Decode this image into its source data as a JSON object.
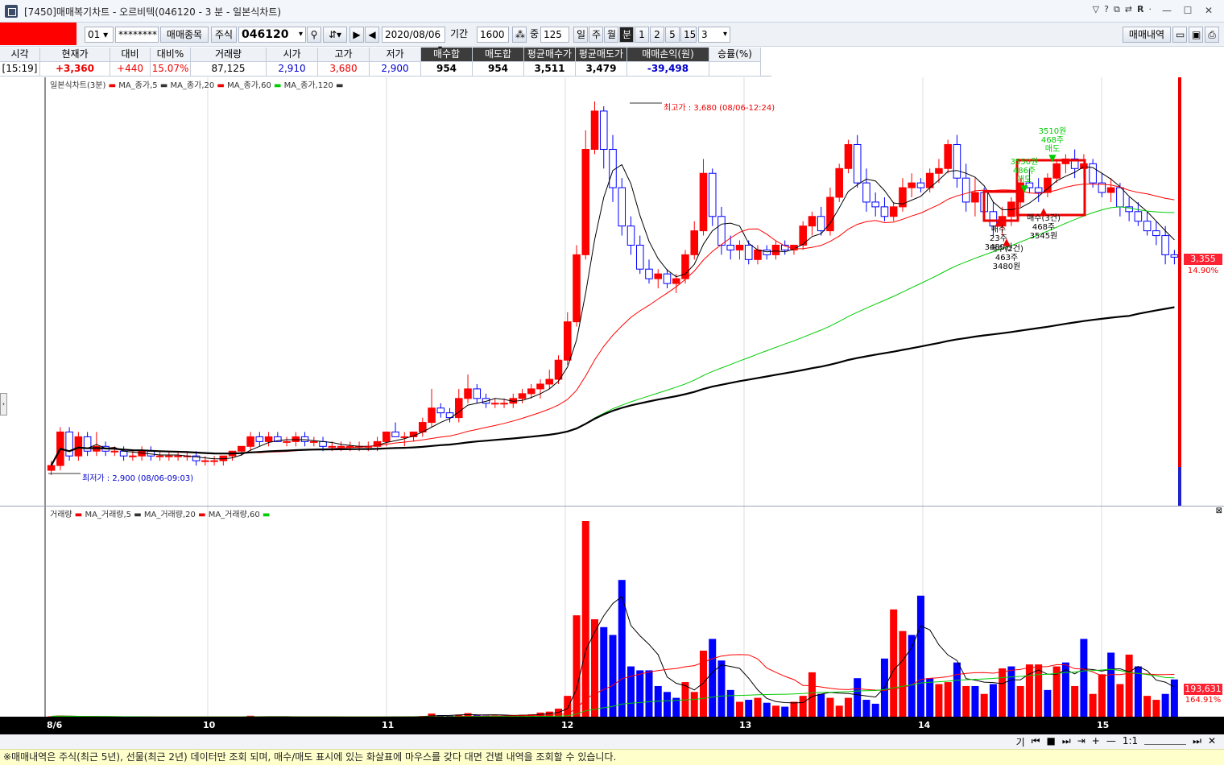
{
  "window": {
    "title": "[7450]매매복기차트 - 오르비텍(046120 - 3 분 - 일본식차트)",
    "icons": [
      "help-icon",
      "question-icon",
      "copy-icon",
      "sync-icon",
      "r-icon",
      "pin-icon",
      "minimize-icon",
      "maximize-icon",
      "close-icon"
    ]
  },
  "toolbar": {
    "account": "01",
    "password": "********",
    "trade_item_btn": "매매종목",
    "market": "주식",
    "code": "046120",
    "date": "2020/08/06",
    "period_label": "기간",
    "period_value": "1600",
    "count_label": "중",
    "count_value": "125",
    "periods": [
      "일",
      "주",
      "월",
      "분"
    ],
    "active_period": "분",
    "minutes": [
      "1",
      "2",
      "5",
      "15"
    ],
    "minute_select": "3",
    "history_btn": "매매내역"
  },
  "quote": {
    "headers": [
      "시각",
      "현재가",
      "대비",
      "대비%",
      "거래량",
      "시가",
      "고가",
      "저가",
      "매수합",
      "매도합",
      "평균매수가",
      "평균매도가",
      "매매손익(원)",
      "승률(%)"
    ],
    "values": [
      "[15:19]",
      "+3,360",
      "+440",
      "15.07%",
      "87,125",
      "2,910",
      "3,680",
      "2,900",
      "954",
      "954",
      "3,511",
      "3,479",
      "-39,498",
      ""
    ]
  },
  "price_panel": {
    "legend_title": "일본식차트(3분)",
    "legend_items": [
      "MA_종가,5",
      "MA_종가,20",
      "MA_종가,60",
      "MA_종가,120"
    ],
    "high_label": "최고가 : 3,680 (08/06-12:24)",
    "low_label": "최저가 : 2,900 (08/06-09:03)",
    "current_price": "3,355",
    "current_pct": "14.90%"
  },
  "trade_marks": [
    {
      "side": "sell",
      "lines": [
        "3510원",
        "468주",
        "매도"
      ]
    },
    {
      "side": "sell",
      "lines": [
        "3550원",
        "486주",
        "매도"
      ]
    },
    {
      "side": "buy",
      "lines": [
        "매수(3건)",
        "468주",
        "3545원"
      ]
    },
    {
      "side": "buy",
      "lines": [
        "매수",
        "23주",
        "3480원"
      ]
    },
    {
      "side": "buy",
      "lines": [
        "매수(2건)",
        "463주",
        "3480원"
      ]
    }
  ],
  "volume_panel": {
    "legend_title": "거래량",
    "legend_items": [
      "MA_거래량,5",
      "MA_거래량,20",
      "MA_거래량,60"
    ],
    "current_volume": "193,631",
    "current_pct": "164.91%"
  },
  "x_axis": {
    "labels": [
      "8/6",
      "10",
      "11",
      "12",
      "13",
      "14",
      "15"
    ]
  },
  "bottom_tools": [
    "기",
    "1:1"
  ],
  "status_text": "※매매내역은 주식(최근 5년), 선물(최근 2년) 데이터만 조회 되며, 매수/매도 표시에 있는 화살표에 마우스를 갖다 대면 건별 내역을 조회할 수 있습니다.",
  "colors": {
    "up": "#ff0000",
    "down": "#0000ff",
    "ma5": "#000000",
    "ma20": "#ff0000",
    "ma60": "#00cc00",
    "ma120": "#000000"
  },
  "chart_data": {
    "type": "candlestick",
    "price_axis": {
      "min": 2900,
      "max": 3680
    },
    "candles": [
      [
        2910,
        2930,
        2900,
        2920
      ],
      [
        2920,
        3000,
        2910,
        2990
      ],
      [
        2990,
        3000,
        2930,
        2940
      ],
      [
        2940,
        2990,
        2930,
        2980
      ],
      [
        2980,
        2990,
        2940,
        2950
      ],
      [
        2950,
        2990,
        2940,
        2960
      ],
      [
        2960,
        2970,
        2940,
        2950
      ],
      [
        2950,
        2960,
        2940,
        2950
      ],
      [
        2950,
        2960,
        2930,
        2940
      ],
      [
        2940,
        2950,
        2930,
        2940
      ],
      [
        2940,
        2960,
        2930,
        2950
      ],
      [
        2950,
        2960,
        2930,
        2940
      ],
      [
        2940,
        2950,
        2930,
        2940
      ],
      [
        2940,
        2950,
        2930,
        2940
      ],
      [
        2940,
        2950,
        2930,
        2940
      ],
      [
        2940,
        2950,
        2930,
        2940
      ],
      [
        2940,
        2950,
        2920,
        2930
      ],
      [
        2930,
        2940,
        2920,
        2930
      ],
      [
        2930,
        2940,
        2920,
        2930
      ],
      [
        2930,
        2940,
        2920,
        2940
      ],
      [
        2940,
        2950,
        2930,
        2950
      ],
      [
        2950,
        2960,
        2940,
        2960
      ],
      [
        2960,
        2990,
        2950,
        2980
      ],
      [
        2980,
        2990,
        2960,
        2970
      ],
      [
        2970,
        2990,
        2960,
        2980
      ],
      [
        2980,
        2990,
        2970,
        2970
      ],
      [
        2970,
        2980,
        2960,
        2970
      ],
      [
        2970,
        2990,
        2960,
        2980
      ],
      [
        2980,
        2990,
        2960,
        2970
      ],
      [
        2970,
        2980,
        2960,
        2970
      ],
      [
        2970,
        2980,
        2950,
        2960
      ],
      [
        2960,
        2970,
        2950,
        2960
      ],
      [
        2960,
        2970,
        2950,
        2960
      ],
      [
        2960,
        2970,
        2950,
        2960
      ],
      [
        2960,
        2970,
        2950,
        2960
      ],
      [
        2960,
        2970,
        2950,
        2960
      ],
      [
        2960,
        2980,
        2950,
        2970
      ],
      [
        2970,
        2990,
        2960,
        2990
      ],
      [
        2990,
        3010,
        2980,
        2980
      ],
      [
        2980,
        2990,
        2960,
        2980
      ],
      [
        2980,
        2990,
        2970,
        2990
      ],
      [
        2990,
        3020,
        2980,
        3010
      ],
      [
        3010,
        3080,
        3000,
        3040
      ],
      [
        3040,
        3050,
        3020,
        3030
      ],
      [
        3030,
        3040,
        3010,
        3020
      ],
      [
        3020,
        3080,
        3010,
        3060
      ],
      [
        3060,
        3110,
        3050,
        3080
      ],
      [
        3080,
        3090,
        3050,
        3060
      ],
      [
        3060,
        3070,
        3040,
        3050
      ],
      [
        3050,
        3060,
        3040,
        3050
      ],
      [
        3050,
        3060,
        3040,
        3050
      ],
      [
        3050,
        3070,
        3040,
        3060
      ],
      [
        3060,
        3080,
        3050,
        3070
      ],
      [
        3070,
        3090,
        3060,
        3080
      ],
      [
        3080,
        3100,
        3060,
        3090
      ],
      [
        3090,
        3120,
        3080,
        3100
      ],
      [
        3100,
        3150,
        3090,
        3140
      ],
      [
        3140,
        3240,
        3130,
        3220
      ],
      [
        3220,
        3380,
        3210,
        3360
      ],
      [
        3360,
        3620,
        3350,
        3580
      ],
      [
        3580,
        3680,
        3570,
        3660
      ],
      [
        3660,
        3670,
        3540,
        3580
      ],
      [
        3580,
        3610,
        3470,
        3500
      ],
      [
        3500,
        3520,
        3400,
        3420
      ],
      [
        3420,
        3440,
        3360,
        3380
      ],
      [
        3380,
        3400,
        3320,
        3330
      ],
      [
        3330,
        3350,
        3300,
        3310
      ],
      [
        3310,
        3330,
        3290,
        3320
      ],
      [
        3320,
        3330,
        3290,
        3300
      ],
      [
        3300,
        3320,
        3280,
        3310
      ],
      [
        3310,
        3370,
        3300,
        3360
      ],
      [
        3360,
        3430,
        3350,
        3410
      ],
      [
        3410,
        3560,
        3400,
        3530
      ],
      [
        3530,
        3540,
        3420,
        3440
      ],
      [
        3440,
        3460,
        3360,
        3380
      ],
      [
        3380,
        3400,
        3350,
        3370
      ],
      [
        3370,
        3390,
        3350,
        3380
      ],
      [
        3380,
        3390,
        3340,
        3350
      ],
      [
        3350,
        3380,
        3340,
        3370
      ],
      [
        3370,
        3380,
        3350,
        3360
      ],
      [
        3360,
        3390,
        3350,
        3380
      ],
      [
        3380,
        3390,
        3360,
        3370
      ],
      [
        3370,
        3380,
        3360,
        3380
      ],
      [
        3380,
        3430,
        3370,
        3420
      ],
      [
        3420,
        3450,
        3400,
        3440
      ],
      [
        3440,
        3460,
        3400,
        3410
      ],
      [
        3410,
        3500,
        3400,
        3480
      ],
      [
        3480,
        3550,
        3470,
        3540
      ],
      [
        3540,
        3600,
        3530,
        3590
      ],
      [
        3590,
        3610,
        3500,
        3510
      ],
      [
        3510,
        3540,
        3450,
        3470
      ],
      [
        3470,
        3490,
        3440,
        3460
      ],
      [
        3460,
        3480,
        3430,
        3440
      ],
      [
        3440,
        3470,
        3430,
        3460
      ],
      [
        3460,
        3520,
        3450,
        3500
      ],
      [
        3500,
        3530,
        3480,
        3510
      ],
      [
        3510,
        3520,
        3490,
        3500
      ],
      [
        3500,
        3540,
        3490,
        3530
      ],
      [
        3530,
        3560,
        3510,
        3540
      ],
      [
        3540,
        3600,
        3530,
        3590
      ],
      [
        3590,
        3610,
        3500,
        3520
      ],
      [
        3520,
        3550,
        3450,
        3470
      ],
      [
        3470,
        3520,
        3440,
        3490
      ],
      [
        3490,
        3500,
        3430,
        3450
      ],
      [
        3450,
        3470,
        3400,
        3420
      ],
      [
        3420,
        3460,
        3400,
        3440
      ],
      [
        3440,
        3480,
        3420,
        3470
      ],
      [
        3470,
        3520,
        3460,
        3510
      ],
      [
        3510,
        3540,
        3490,
        3500
      ],
      [
        3500,
        3520,
        3470,
        3490
      ],
      [
        3490,
        3530,
        3480,
        3520
      ],
      [
        3520,
        3560,
        3510,
        3550
      ],
      [
        3550,
        3570,
        3530,
        3560
      ],
      [
        3560,
        3580,
        3520,
        3540
      ],
      [
        3540,
        3570,
        3520,
        3550
      ],
      [
        3550,
        3560,
        3500,
        3510
      ],
      [
        3510,
        3530,
        3480,
        3490
      ],
      [
        3490,
        3520,
        3470,
        3500
      ],
      [
        3500,
        3510,
        3440,
        3460
      ],
      [
        3460,
        3480,
        3430,
        3450
      ],
      [
        3450,
        3470,
        3420,
        3430
      ],
      [
        3430,
        3450,
        3400,
        3410
      ],
      [
        3410,
        3430,
        3380,
        3400
      ],
      [
        3400,
        3420,
        3340,
        3360
      ],
      [
        3360,
        3370,
        3340,
        3355
      ]
    ],
    "volume_axis": {
      "min": 0,
      "max": 1000000
    },
    "volumes": [
      6000,
      9000,
      5000,
      4000,
      3000,
      3000,
      3000,
      2000,
      2000,
      2000,
      2000,
      2000,
      2000,
      2000,
      2000,
      2000,
      2000,
      2000,
      2000,
      2000,
      3000,
      3000,
      9000,
      4000,
      4000,
      3000,
      3000,
      4000,
      3000,
      3000,
      2000,
      2000,
      2000,
      2000,
      2000,
      2000,
      3000,
      4000,
      5000,
      4000,
      5000,
      8000,
      20000,
      12000,
      9000,
      15000,
      22000,
      12000,
      10000,
      10000,
      10000,
      12000,
      14000,
      16000,
      25000,
      30000,
      45000,
      110000,
      520000,
      1000000,
      500000,
      460000,
      420000,
      700000,
      260000,
      240000,
      240000,
      160000,
      130000,
      100000,
      180000,
      130000,
      340000,
      400000,
      290000,
      140000,
      80000,
      90000,
      100000,
      75000,
      60000,
      55000,
      80000,
      110000,
      230000,
      120000,
      100000,
      60000,
      100000,
      200000,
      90000,
      70000,
      300000,
      550000,
      440000,
      420000,
      620000,
      200000,
      170000,
      180000,
      280000,
      160000,
      160000,
      120000,
      170000,
      250000,
      260000,
      160000,
      270000,
      270000,
      140000,
      260000,
      280000,
      160000,
      400000,
      120000,
      220000,
      330000,
      170000,
      320000,
      260000,
      110000,
      90000,
      120000,
      193631
    ],
    "volume_up": [
      1,
      1,
      0,
      1,
      0,
      1,
      0,
      1,
      0,
      1,
      1,
      0,
      1,
      0,
      1,
      0,
      1,
      0,
      1,
      1,
      1,
      1,
      1,
      0,
      1,
      0,
      1,
      1,
      0,
      1,
      0,
      1,
      0,
      1,
      0,
      1,
      1,
      1,
      0,
      1,
      1,
      1,
      1,
      0,
      0,
      1,
      1,
      0,
      0,
      1,
      0,
      1,
      1,
      1,
      1,
      1,
      1,
      1,
      1,
      1,
      1,
      0,
      0,
      0,
      0,
      0,
      0,
      0,
      0,
      0,
      1,
      1,
      1,
      0,
      0,
      0,
      1,
      0,
      1,
      0,
      1,
      0,
      1,
      1,
      1,
      0,
      1,
      1,
      1,
      0,
      0,
      0,
      0,
      1,
      1,
      0,
      0,
      0,
      1,
      1,
      0,
      1,
      0,
      1,
      0,
      1,
      0,
      1,
      1,
      1,
      0,
      1,
      0,
      1,
      0,
      1,
      1,
      0,
      1,
      1,
      0,
      1,
      1,
      0,
      0
    ],
    "x_labels": [
      "8/6",
      "10",
      "11",
      "12",
      "13",
      "14",
      "15"
    ]
  }
}
